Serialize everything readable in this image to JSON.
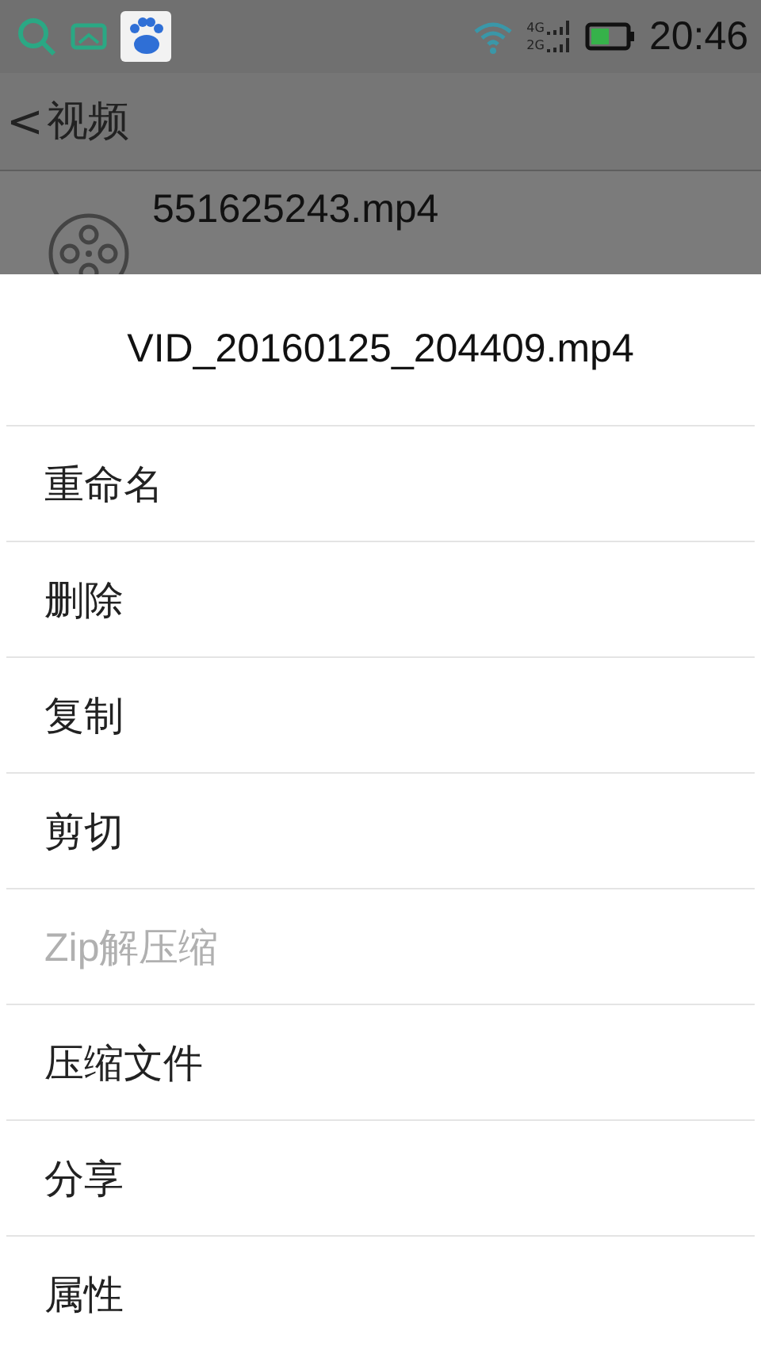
{
  "status_bar": {
    "network_top": "4G",
    "network_bottom": "2G",
    "time": "20:46"
  },
  "header": {
    "back": "<",
    "title": "视频"
  },
  "file_row": {
    "name": "551625243.mp4"
  },
  "sheet": {
    "title": "VID_20160125_204409.mp4",
    "items": [
      {
        "label": "重命名",
        "disabled": false
      },
      {
        "label": "删除",
        "disabled": false
      },
      {
        "label": "复制",
        "disabled": false
      },
      {
        "label": "剪切",
        "disabled": false
      },
      {
        "label": "Zip解压缩",
        "disabled": true
      },
      {
        "label": "压缩文件",
        "disabled": false
      },
      {
        "label": "分享",
        "disabled": false
      },
      {
        "label": "属性",
        "disabled": false
      }
    ]
  }
}
